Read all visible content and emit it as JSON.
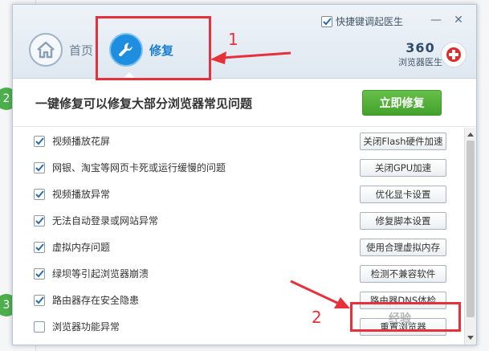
{
  "header": {
    "tabs": [
      {
        "label": "首页",
        "icon": "home-icon"
      },
      {
        "label": "修复",
        "icon": "wrench-icon",
        "active": true
      }
    ],
    "hotkey_label": "快捷键调起医生",
    "hotkey_checked": true,
    "minimize_glyph": "—",
    "close_glyph": "✕",
    "brand_number": "360",
    "brand_subtitle": "浏览器医生"
  },
  "background": {
    "steps": [
      "2",
      "3"
    ]
  },
  "banner": {
    "text": "一键修复可以修复大部分浏览器常见问题",
    "button_label": "立即修复"
  },
  "items": [
    {
      "label": "视频播放花屏",
      "checked": true,
      "button": "关闭Flash硬件加速"
    },
    {
      "label": "网银、淘宝等网页卡死或运行缓慢的问题",
      "checked": true,
      "button": "关闭GPU加速"
    },
    {
      "label": "视频播放异常",
      "checked": true,
      "button": "优化显卡设置"
    },
    {
      "label": "无法自动登录或网站异常",
      "checked": true,
      "button": "修复脚本设置"
    },
    {
      "label": "虚拟内存问题",
      "checked": true,
      "button": "使用合理虚拟内存"
    },
    {
      "label": "绿坝等引起浏览器崩溃",
      "checked": true,
      "button": "检测不兼容软件"
    },
    {
      "label": "路由器存在安全隐患",
      "checked": true,
      "button": "路由器DNS体检"
    },
    {
      "label": "浏览器功能异常",
      "checked": false,
      "button": "重置浏览器"
    }
  ],
  "annotations": {
    "step1": "1",
    "step2": "2",
    "color": "#e8303b"
  },
  "watermark": "经验"
}
